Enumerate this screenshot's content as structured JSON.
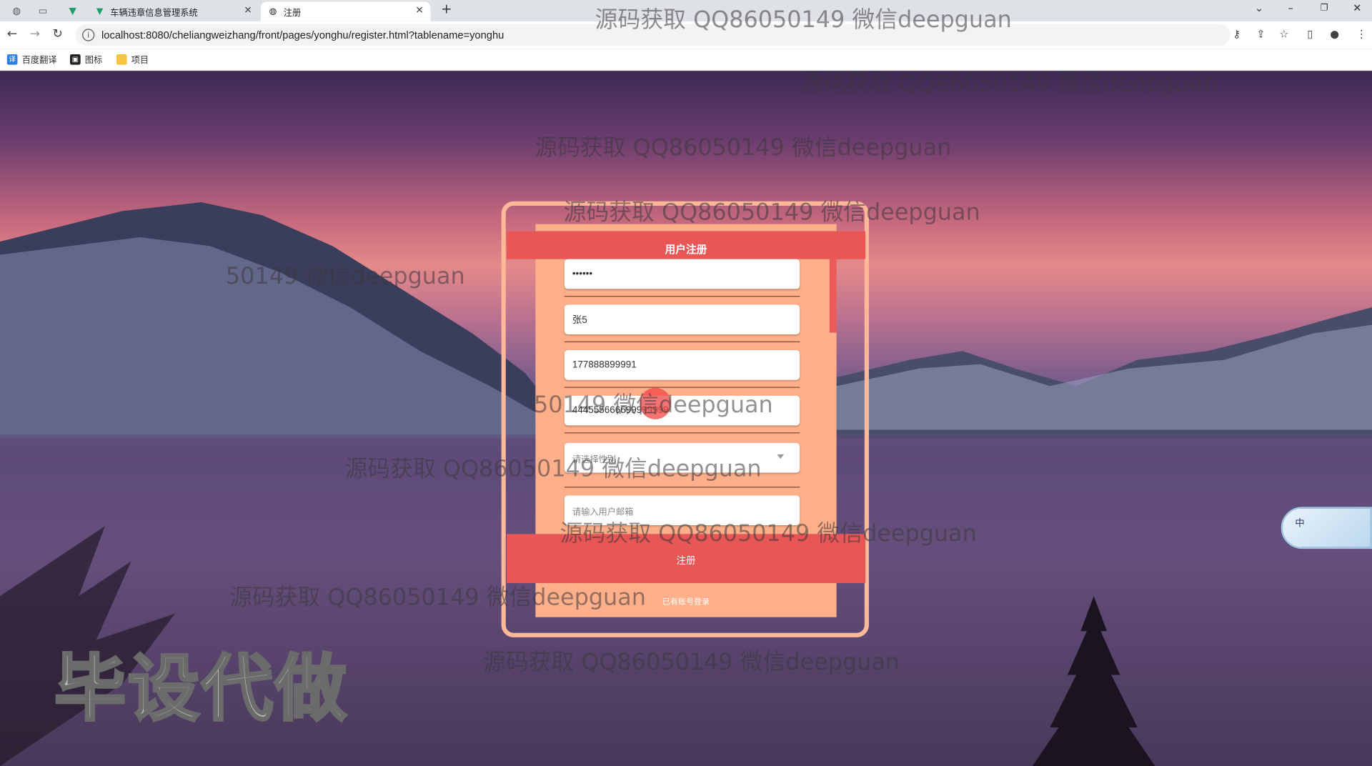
{
  "browser": {
    "tabs": [
      {
        "title": "车辆违章信息管理系统",
        "icon": "v-logo-icon"
      },
      {
        "title": "注册",
        "icon": "globe-icon"
      }
    ],
    "new_tab": "+",
    "url": "localhost:8080/cheliangweizhang/front/pages/yonghu/register.html?tablename=yonghu",
    "bookmarks": [
      {
        "label": "百度翻译",
        "icon": "translate-icon",
        "color": "#2f7de1"
      },
      {
        "label": "图标",
        "icon": "bookmark-icon",
        "color": "#222222"
      },
      {
        "label": "项目",
        "icon": "folder-icon",
        "color": "#f5c542"
      }
    ]
  },
  "form": {
    "title": "用户注册",
    "fields": {
      "password_confirm": "••••••",
      "name": "张5",
      "phone": "177888899991",
      "id_card": "444555666699999999",
      "gender_placeholder": "请选择性别",
      "email_placeholder": "请输入用户邮箱"
    },
    "submit_label": "注册",
    "login_link": "已有账号登录"
  },
  "overlay": {
    "watermark": "源码获取 QQ86050149 微信deepguan",
    "watermark_partial": "50149 微信deepguan",
    "big_mark": "毕设代做",
    "ime_label": "中"
  },
  "colors": {
    "accent": "#e95656",
    "panel": "#ffb08a",
    "frame": "#ffb898"
  }
}
